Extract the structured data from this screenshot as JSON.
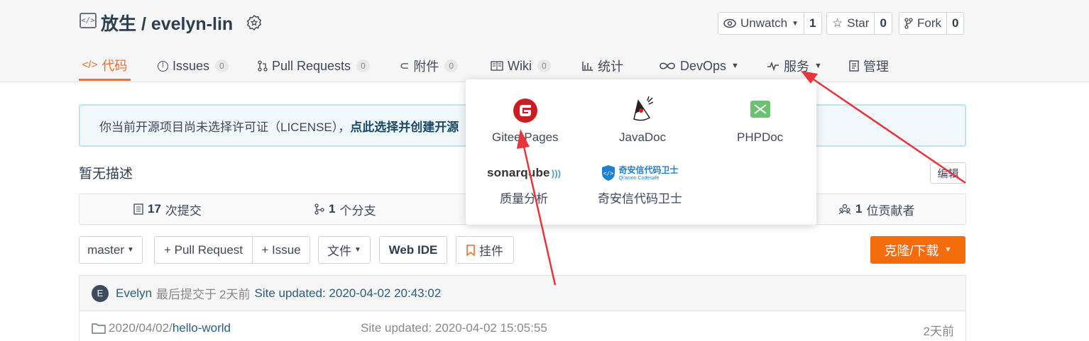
{
  "repo": {
    "title": "放生 / evelyn-lin",
    "icon": "code-repo-icon"
  },
  "actions": {
    "watch_label": "Unwatch",
    "watch_count": "1",
    "star_label": "Star",
    "star_count": "0",
    "fork_label": "Fork",
    "fork_count": "0"
  },
  "tabs": {
    "code": "代码",
    "issues": "Issues",
    "issues_count": "0",
    "pulls": "Pull Requests",
    "pulls_count": "0",
    "attachments": "附件",
    "attachments_count": "0",
    "wiki": "Wiki",
    "wiki_count": "0",
    "stats": "统计",
    "devops": "DevOps",
    "services": "服务",
    "manage": "管理"
  },
  "notice": {
    "text": "你当前开源项目尚未选择许可证（LICENSE），",
    "link": "点此选择并创建开源"
  },
  "description": {
    "text": "暂无描述",
    "edit": "编辑"
  },
  "stats": {
    "commits_num": "17",
    "commits_label": "次提交",
    "branches_num": "1",
    "branches_label": "个分支",
    "contributors_num": "1",
    "contributors_label": "位贡献者"
  },
  "toolbar": {
    "branch": "master",
    "pull_request": "+ Pull Request",
    "issue": "+ Issue",
    "files": "文件",
    "web_ide": "Web IDE",
    "widget": "挂件",
    "clone": "克隆/下载"
  },
  "commit": {
    "avatar": "E",
    "author": "Evelyn",
    "meta": "最后提交于",
    "time": "2天前",
    "message": "Site updated: 2020-04-02 20:43:02"
  },
  "files": [
    {
      "path_prefix": "2020/04/02/",
      "path_name": "hello-world",
      "message": "Site updated: 2020-04-02 15:05:55",
      "time": "2天前"
    }
  ],
  "services_menu": {
    "gitee_pages": "Gitee Pages",
    "javadoc": "JavaDoc",
    "phpdoc": "PHPDoc",
    "sonar_logo": "sonarqube",
    "sonar": "质量分析",
    "qianxin_logo": "奇安信代码卫士",
    "qianxin_sub": "Qi'anxin Codesafe",
    "qianxin": "奇安信代码卫士"
  },
  "colors": {
    "accent": "#f56c2d",
    "clone": "#f56c0d",
    "gitee_red": "#c71d23",
    "annotation_arrow": "#e8343a"
  }
}
